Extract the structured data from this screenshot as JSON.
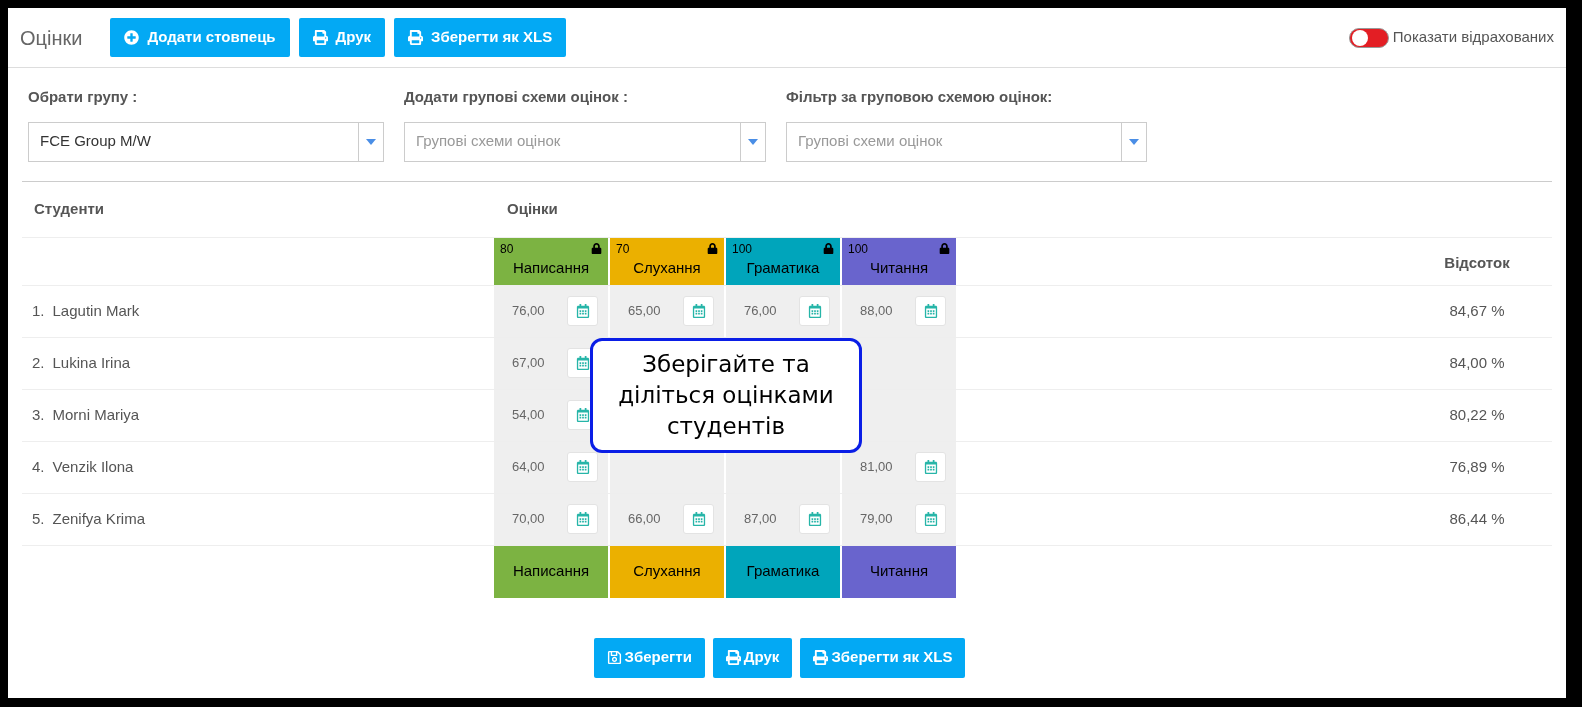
{
  "header": {
    "title": "Оцінки",
    "buttons": [
      {
        "label": "Додати стовпець",
        "kind": "add"
      },
      {
        "label": "Друк",
        "kind": "print"
      },
      {
        "label": "Зберегти як XLS",
        "kind": "print"
      }
    ],
    "toggle": {
      "label": "Показати відрахованих",
      "on": false
    }
  },
  "filters": [
    {
      "label": "Обрати групу :",
      "value": "FCE Group M/W"
    },
    {
      "label": "Додати групові схеми оцінок :",
      "placeholder": "Групові схеми оцінок"
    },
    {
      "label": "Фільтр за груповою схемою оцінок:",
      "placeholder": "Групові схеми оцінок"
    }
  ],
  "table": {
    "headings": {
      "students": "Студенти",
      "grades": "Оцінки",
      "percent": "Відсоток"
    },
    "grade_columns": [
      {
        "max": "80",
        "name": "Написання",
        "color": "#7cb342",
        "locked": true
      },
      {
        "max": "70",
        "name": "Слухання",
        "color": "#ebb000",
        "locked": true
      },
      {
        "max": "100",
        "name": "Граматика",
        "color": "#00a5bb",
        "locked": true
      },
      {
        "max": "100",
        "name": "Читання",
        "color": "#6964cd",
        "locked": true
      }
    ],
    "rows": [
      {
        "number": "1.",
        "name": "Lagutin Mark",
        "grades": [
          {
            "kind": "grade",
            "value": "76,00"
          },
          {
            "kind": "grade",
            "value": "65,00"
          },
          {
            "kind": "grade",
            "value": "76,00"
          },
          {
            "kind": "grade",
            "value": "88,00"
          }
        ],
        "percent": "84,67 %"
      },
      {
        "number": "2.",
        "name": "Lukina Irina",
        "grades": [
          {
            "kind": "grade",
            "value": "67,00"
          },
          {
            "kind": "covered"
          },
          {
            "kind": "covered"
          },
          {
            "kind": "partial"
          }
        ],
        "percent": "84,00 %"
      },
      {
        "number": "3.",
        "name": "Morni Mariya",
        "grades": [
          {
            "kind": "grade",
            "value": "54,00"
          },
          {
            "kind": "covered"
          },
          {
            "kind": "covered"
          },
          {
            "kind": "partial"
          }
        ],
        "percent": "80,22 %"
      },
      {
        "number": "4.",
        "name": "Venzik Ilona",
        "grades": [
          {
            "kind": "grade",
            "value": "64,00"
          },
          {
            "kind": "partial"
          },
          {
            "kind": "partial"
          },
          {
            "kind": "grade",
            "value": "81,00"
          }
        ],
        "percent": "76,89 %"
      },
      {
        "number": "5.",
        "name": "Zenifya Krima",
        "grades": [
          {
            "kind": "grade",
            "value": "70,00"
          },
          {
            "kind": "grade",
            "value": "66,00"
          },
          {
            "kind": "grade",
            "value": "87,00"
          },
          {
            "kind": "grade",
            "value": "79,00"
          }
        ],
        "percent": "86,44 %"
      }
    ],
    "footer": [
      {
        "name": "Написання",
        "color": "#7cb342"
      },
      {
        "name": "Слухання",
        "color": "#ebb000"
      },
      {
        "name": "Граматика",
        "color": "#00a5bb"
      },
      {
        "name": "Читання",
        "color": "#6964cd"
      }
    ]
  },
  "callout": {
    "text": "Зберігайте та діліться оцінками студентів"
  },
  "actions": [
    {
      "label": "Зберегти",
      "kind": "save"
    },
    {
      "label": "Друк",
      "kind": "print"
    },
    {
      "label": "Зберегти як XLS",
      "kind": "print"
    }
  ]
}
